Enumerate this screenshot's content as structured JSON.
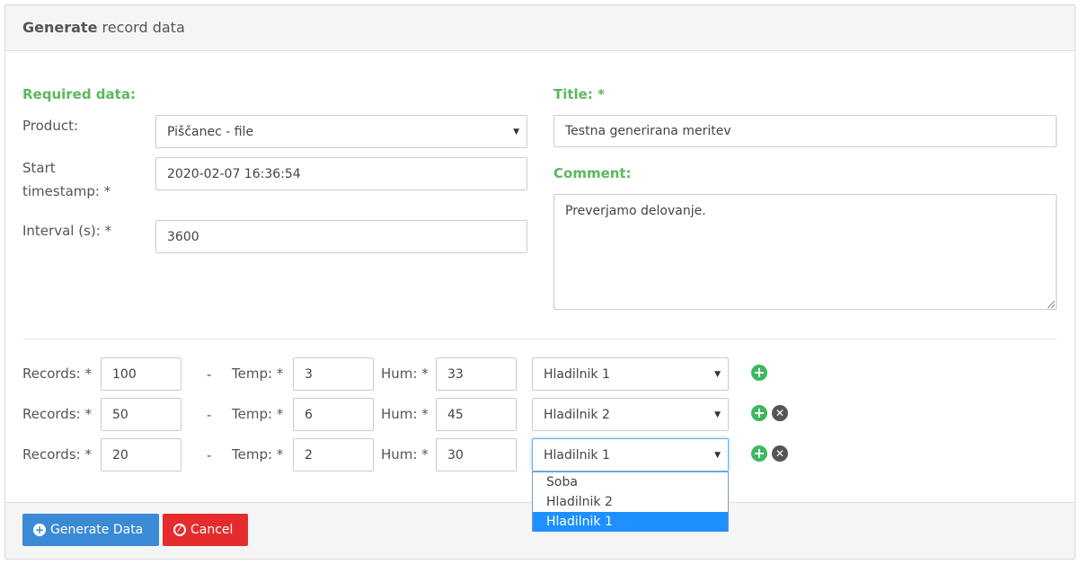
{
  "header": {
    "title_bold": "Generate",
    "title_rest": " record data"
  },
  "required": {
    "heading": "Required data:",
    "product_label": "Product:",
    "product_value": "Piščanec - file",
    "start_label_1": "Start",
    "start_label_2": "timestamp: *",
    "start_value": "2020-02-07 16:36:54",
    "interval_label": "Interval (s): *",
    "interval_value": "3600"
  },
  "title_section": {
    "label": "Title: *",
    "value": "Testna generirana meritev"
  },
  "comment_section": {
    "label": "Comment:",
    "value": "Preverjamo delovanje."
  },
  "row_labels": {
    "records": "Records: *",
    "dash": "-",
    "temp": "Temp: *",
    "hum": "Hum: *"
  },
  "rows": [
    {
      "records": "100",
      "temp": "3",
      "hum": "33",
      "device": "Hladilnik 1"
    },
    {
      "records": "50",
      "temp": "6",
      "hum": "45",
      "device": "Hladilnik 2"
    },
    {
      "records": "20",
      "temp": "2",
      "hum": "30",
      "device": "Hladilnik 1"
    }
  ],
  "dropdown_options": [
    "Soba",
    "Hladilnik 2",
    "Hladilnik 1"
  ],
  "footer": {
    "generate_label": "Generate Data",
    "cancel_label": "Cancel"
  },
  "colors": {
    "section_label": "#5cb85c",
    "primary": "#3a8ad6",
    "danger": "#e52b2b",
    "add_icon": "#3cb85c",
    "remove_icon": "#555555",
    "selected_option": "#1e90ff"
  }
}
